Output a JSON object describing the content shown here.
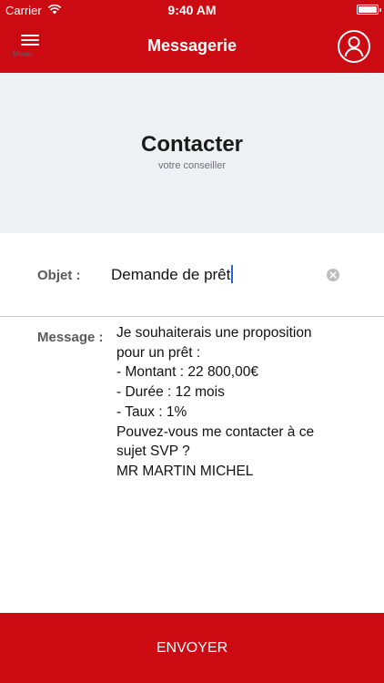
{
  "status_bar": {
    "carrier": "Carrier",
    "time": "9:40 AM"
  },
  "nav": {
    "menu_label": "Menu",
    "title": "Messagerie",
    "menu_icon": "hamburger-menu-icon",
    "profile_icon": "user-profile-icon"
  },
  "header": {
    "title": "Contacter",
    "subtitle": "votre conseiller"
  },
  "form": {
    "objet_label": "Objet :",
    "objet_value": "Demande de prêt",
    "message_label": "Message :",
    "message_lines": [
      "Je souhaiterais une proposition",
      "pour un prêt :",
      "- Montant : 22 800,00€",
      "- Durée : 12 mois",
      "- Taux : 1%",
      "Pouvez-vous me contacter à ce",
      "sujet SVP ?",
      "MR MARTIN MICHEL"
    ]
  },
  "send_button": "ENVOYER",
  "colors": {
    "brand_red": "#cc0a12",
    "header_background": "#eef0f3",
    "caret_blue": "#2a61e0"
  }
}
